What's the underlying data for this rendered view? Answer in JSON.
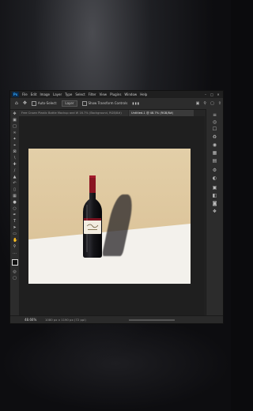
{
  "menu": {
    "items": [
      "File",
      "Edit",
      "Image",
      "Layer",
      "Type",
      "Select",
      "Filter",
      "View",
      "Plugins",
      "Window",
      "Help"
    ]
  },
  "options": {
    "auto_select": "Auto-Select:",
    "layer_select": "Layer",
    "show_transform": "Show Transform Controls"
  },
  "tabs": [
    {
      "label": "Free Crown Plastic Bottle Mockup and W 16.7% (Background, RGB/8#)",
      "active": false
    },
    {
      "label": "Untitled-1 @ 48.7% (RGB/8#)",
      "active": true
    }
  ],
  "status": {
    "zoom": "48.66%",
    "doc": "1080 px x 1190 px (72 ppi)"
  },
  "colors": {
    "accent": "#31a8ff",
    "wall": "#dcc49a",
    "floor": "#f3f1ec",
    "bottle": "#1a1a1e",
    "label": "#f2ece0",
    "cap": "#8a1422"
  }
}
